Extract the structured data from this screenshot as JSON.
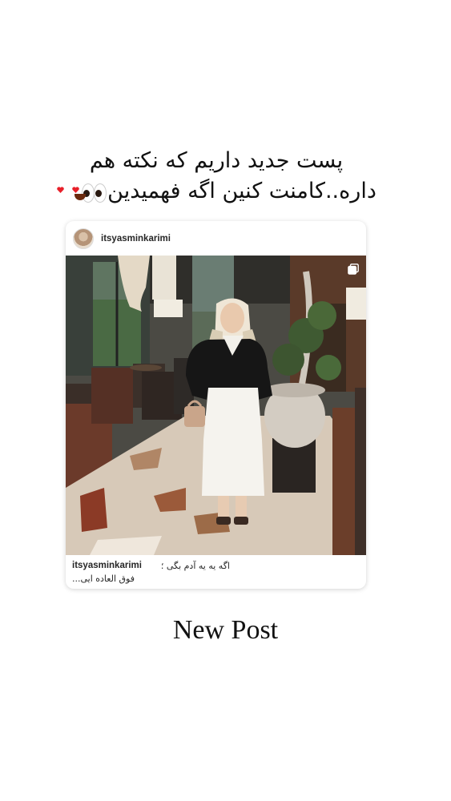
{
  "story": {
    "headline_line1": "پست جدید داریم که نکته هم",
    "headline_line2": "داره..کامنت کنین اگه فهمیدین",
    "emojis": [
      "eyes-icon",
      "heart-eyes-face-icon"
    ]
  },
  "post_card": {
    "username": "itsyasminkarimi",
    "caption_user": "itsyasminkarimi",
    "caption_line1": "اگه یه یه آدم بگی ؛",
    "caption_line2": "فوق العاده ایی...",
    "multi_image_indicator": "carousel-icon"
  },
  "footer": {
    "label": "New Post"
  }
}
